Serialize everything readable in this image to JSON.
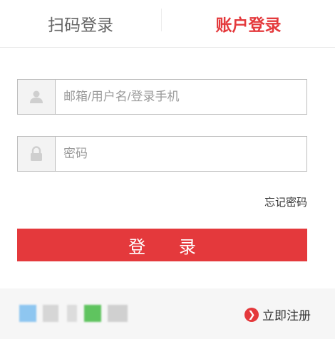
{
  "tabs": [
    {
      "label": "扫码登录"
    },
    {
      "label": "账户登录"
    }
  ],
  "form": {
    "username": {
      "placeholder": "邮箱/用户名/登录手机",
      "value": ""
    },
    "password": {
      "placeholder": "密码",
      "value": ""
    },
    "forgot_label": "忘记密码",
    "submit_label": "登 录"
  },
  "footer": {
    "register_label": "立即注册"
  },
  "colors": {
    "accent": "#e4393c",
    "muted_text": "#666666",
    "icon_bg": "#f3f3f3",
    "footer_bg": "#f6f6f6"
  }
}
